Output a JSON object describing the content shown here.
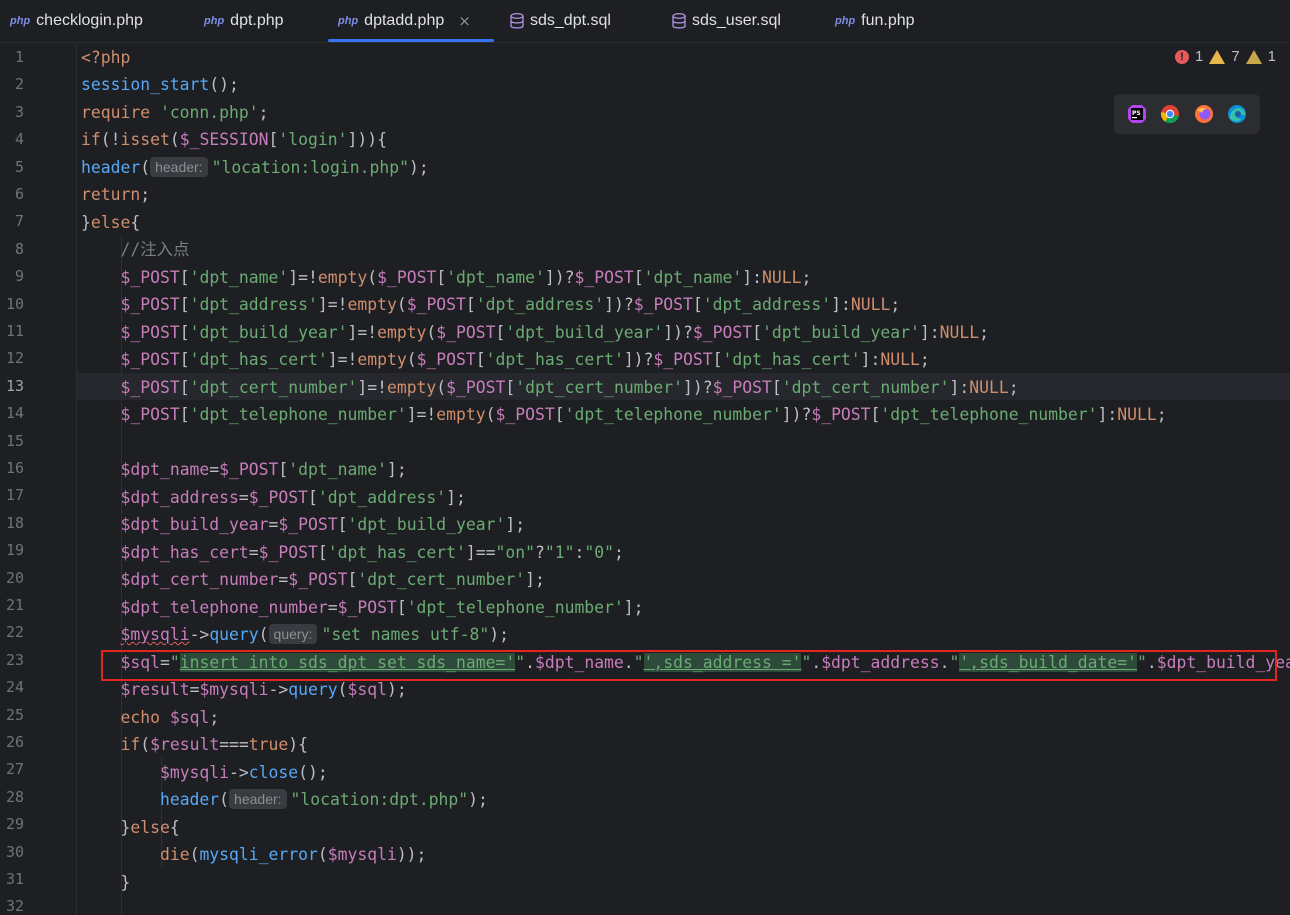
{
  "tabs": [
    {
      "label": "checklogin.php",
      "icon": "php-file-icon",
      "active": false
    },
    {
      "label": "dpt.php",
      "icon": "php-file-icon",
      "active": false
    },
    {
      "label": "dptadd.php",
      "icon": "php-file-icon",
      "active": true
    },
    {
      "label": "sds_dpt.sql",
      "icon": "database-file-icon",
      "active": false
    },
    {
      "label": "sds_user.sql",
      "icon": "database-file-icon",
      "active": false
    },
    {
      "label": "fun.php",
      "icon": "php-file-icon",
      "active": false
    }
  ],
  "php_icon_text": "php",
  "close_glyph": "×",
  "inspections": {
    "errors": "1",
    "warnings": "7",
    "weak_warnings": "1",
    "error_glyph": "!"
  },
  "browsers": [
    "phpstorm-icon",
    "chrome-icon",
    "firefox-icon",
    "edge-icon"
  ],
  "current_line": "13",
  "hints": {
    "header": "header:",
    "query": "query:"
  },
  "code": {
    "l1": "<?php",
    "l2a": "session_start",
    "l2b": "();",
    "l3a": "require",
    "l3b": " 'conn.php'",
    "l3c": ";",
    "l4a": "if",
    "l4b": "(!",
    "l4c": "isset",
    "l4d": "(",
    "l4e": "$_SESSION",
    "l4f": "[",
    "l4g": "'login'",
    "l4h": "])){",
    "l5a": "header",
    "l5b": "(",
    "l5c": "\"location:login.php\"",
    "l5d": ");",
    "l6a": "return",
    "l6b": ";",
    "l7a": "}",
    "l7b": "else",
    "l7c": "{",
    "l8": "//注入点",
    "post": "$_POST",
    "empty": "empty",
    "null": "NULL",
    "k_name": "'dpt_name'",
    "k_address": "'dpt_address'",
    "k_year": "'dpt_build_year'",
    "k_cert": "'dpt_has_cert'",
    "k_certno": "'dpt_cert_number'",
    "k_tel": "'dpt_telephone_number'",
    "v_name": "$dpt_name",
    "v_address": "$dpt_address",
    "v_year": "$dpt_build_year",
    "v_cert": "$dpt_has_cert",
    "v_certno": "$dpt_cert_number",
    "v_tel": "$dpt_telephone_number",
    "on": "\"on\"",
    "one": "\"1\"",
    "zero": "\"0\"",
    "mysqli": "$mysqli",
    "query": "query",
    "names": "\"set names utf-8\"",
    "sql": "$sql",
    "s1": "insert into sds_dpt set sds_name='",
    "s2": "',sds_address ='",
    "s3": "',sds_build_date='",
    "dq": "\"",
    "result": "$result",
    "echo": "echo",
    "true": "true",
    "close": "close",
    "loc_dpt": "\"location:dpt.php\"",
    "die": "die",
    "mysqli_error": "mysqli_error"
  }
}
